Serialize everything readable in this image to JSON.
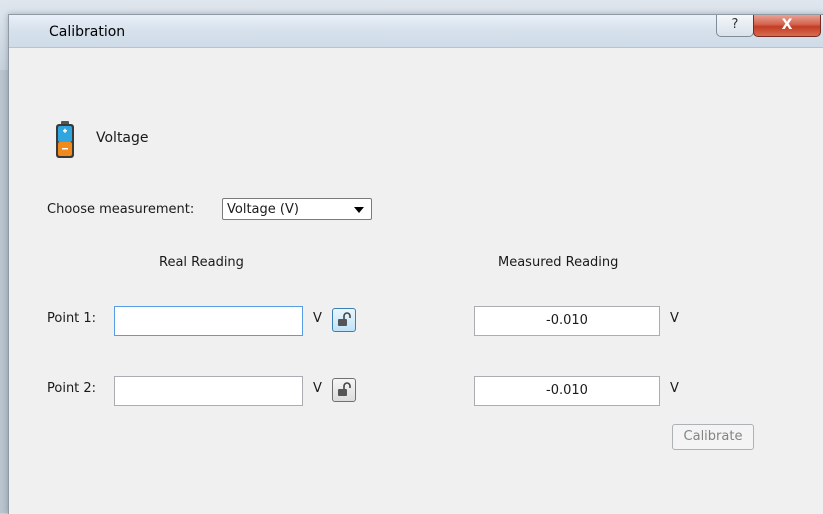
{
  "window": {
    "title": "Calibration",
    "help_label": "?",
    "close_label": "X"
  },
  "header": {
    "icon": "battery-icon",
    "title": "Voltage"
  },
  "measurement": {
    "label": "Choose measurement:",
    "selected": "Voltage (V)"
  },
  "columns": {
    "real": "Real Reading",
    "measured": "Measured Reading"
  },
  "points": [
    {
      "label": "Point 1:",
      "real_value": "",
      "unit": "V",
      "measured_value": "-0.010",
      "measured_unit": "V"
    },
    {
      "label": "Point 2:",
      "real_value": "",
      "unit": "V",
      "measured_value": "-0.010",
      "measured_unit": "V"
    }
  ],
  "actions": {
    "calibrate_label": "Calibrate"
  }
}
